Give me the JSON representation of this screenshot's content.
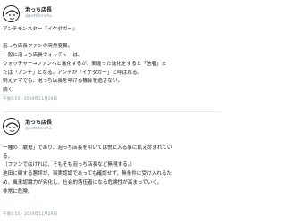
{
  "tweets": [
    {
      "display_name": "泡っち店長",
      "handle": "@kettitencho",
      "lines": [
        "アンチモンスター『イケダガー』",
        "",
        "泡っち店長ファンの突然変異。",
        "一般に泡っち店長ウォッチャーは、",
        "ウォッチャー→ファンへと進化するが、間違った進化をすると「信者」ま",
        "たは「アンチ」となる。アンチが「イケダガー」と呼ばれる。",
        "例えデマでも、泡っち店長を叩ける機会を逃さない。",
        "続く"
      ],
      "timestamp": "午後5:55 · 2019年11月29日"
    },
    {
      "display_name": "泡っち店長",
      "handle": "@kettitencho",
      "lines": [
        "一種の「膿鬼」であり、泡っち店長を叩いては悦に入る事に飢え苛まれてい",
        "る。",
        "（ファンではければ、そもそも泡っち店長など無視する。）",
        "池田に関する悪評が、事実認認であっても確認せず、無条件に受け入れるた",
        "め、風来認識力が劣化し、社会的落伍者になる危険性が高まっていく。",
        "非常に危険。"
      ],
      "timestamp": "午後5:55 · 2019年11月29日"
    }
  ]
}
